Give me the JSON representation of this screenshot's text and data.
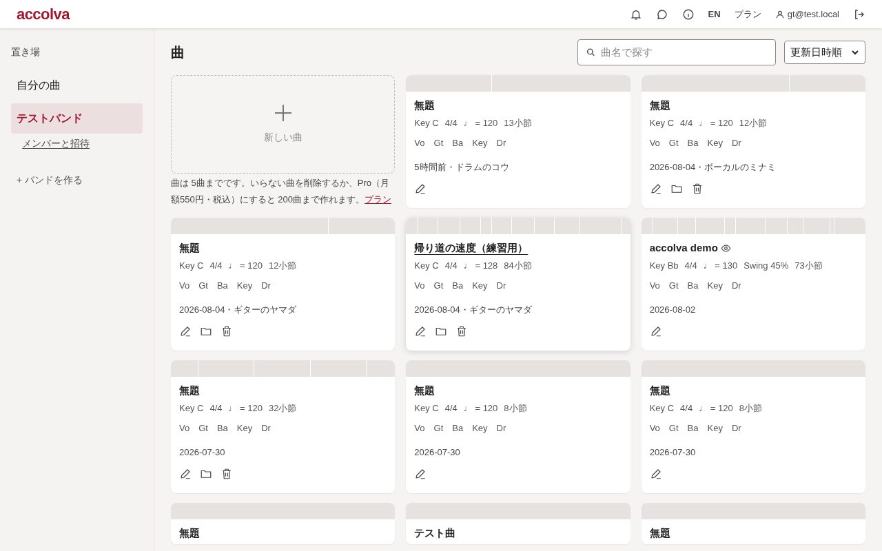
{
  "header": {
    "logo": "accolva",
    "language": "EN",
    "plan_link": "プラン",
    "user": "gt@test.local"
  },
  "sidebar": {
    "section_title": "置き場",
    "items": [
      {
        "label": "自分の曲",
        "selected": false,
        "kind": "nav"
      },
      {
        "label": "テストバンド",
        "selected": true,
        "kind": "nav"
      },
      {
        "label": "メンバーと招待",
        "selected": false,
        "kind": "sub"
      },
      {
        "label": "+ バンドを作る",
        "selected": false,
        "kind": "action"
      }
    ]
  },
  "page": {
    "title": "曲",
    "search": {
      "placeholder": "曲名で探す"
    },
    "sort": {
      "value": "更新日時順"
    }
  },
  "new_song": {
    "label": "新しい曲",
    "notice": "曲は 5曲までです。いらない曲を削除するか、Pro（月額550円・税込）にすると 200曲まで作れます。",
    "notice_link": "プラン"
  },
  "songs": [
    {
      "title": "無題",
      "meta": [
        "Key C",
        "4/4",
        "♩ = 120",
        "13小節"
      ],
      "parts": [
        "Vo",
        "Gt",
        "Ba",
        "Key",
        "Dr"
      ],
      "updated": "5時間前・ドラムのコウ",
      "can_manage": false,
      "public": false,
      "hovered": false
    },
    {
      "title": "無題",
      "meta": [
        "Key C",
        "4/4",
        "♩ = 120",
        "12小節"
      ],
      "parts": [
        "Vo",
        "Gt",
        "Ba",
        "Key",
        "Dr"
      ],
      "updated": "2026-08-04・ボーカルのミナミ",
      "can_manage": true,
      "public": false,
      "hovered": false
    },
    {
      "title": "無題",
      "meta": [
        "Key C",
        "4/4",
        "♩ = 120",
        "12小節"
      ],
      "parts": [
        "Vo",
        "Gt",
        "Ba",
        "Key",
        "Dr"
      ],
      "updated": "2026-08-04・ギターのヤマダ",
      "can_manage": true,
      "public": false,
      "hovered": false
    },
    {
      "title": "帰り道の速度（練習用）",
      "meta": [
        "Key C",
        "4/4",
        "♩ = 128",
        "84小節"
      ],
      "parts": [
        "Vo",
        "Gt",
        "Ba",
        "Key",
        "Dr"
      ],
      "updated": "2026-08-04・ギターのヤマダ",
      "can_manage": true,
      "public": false,
      "hovered": true
    },
    {
      "title": "accolva demo",
      "meta": [
        "Key Bb",
        "4/4",
        "♩ = 130",
        "Swing 45%",
        "73小節"
      ],
      "parts": [
        "Vo",
        "Gt",
        "Ba",
        "Key",
        "Dr"
      ],
      "updated": "2026-08-02",
      "can_manage": false,
      "public": true,
      "hovered": false
    },
    {
      "title": "無題",
      "meta": [
        "Key C",
        "4/4",
        "♩ = 120",
        "32小節"
      ],
      "parts": [
        "Vo",
        "Gt",
        "Ba",
        "Key",
        "Dr"
      ],
      "updated": "2026-07-30",
      "can_manage": true,
      "public": false,
      "hovered": false
    },
    {
      "title": "無題",
      "meta": [
        "Key C",
        "4/4",
        "♩ = 120",
        "8小節"
      ],
      "parts": [
        "Vo",
        "Gt",
        "Ba",
        "Key",
        "Dr"
      ],
      "updated": "2026-07-30",
      "can_manage": false,
      "public": false,
      "hovered": false
    },
    {
      "title": "無題",
      "meta": [
        "Key C",
        "4/4",
        "♩ = 120",
        "8小節"
      ],
      "parts": [
        "Vo",
        "Gt",
        "Ba",
        "Key",
        "Dr"
      ],
      "updated": "2026-07-30",
      "can_manage": false,
      "public": false,
      "hovered": false
    },
    {
      "title": "無題",
      "public": false,
      "hovered": false
    },
    {
      "title": "テスト曲",
      "public": false,
      "hovered": false
    },
    {
      "title": "無題",
      "public": false,
      "hovered": false
    }
  ]
}
